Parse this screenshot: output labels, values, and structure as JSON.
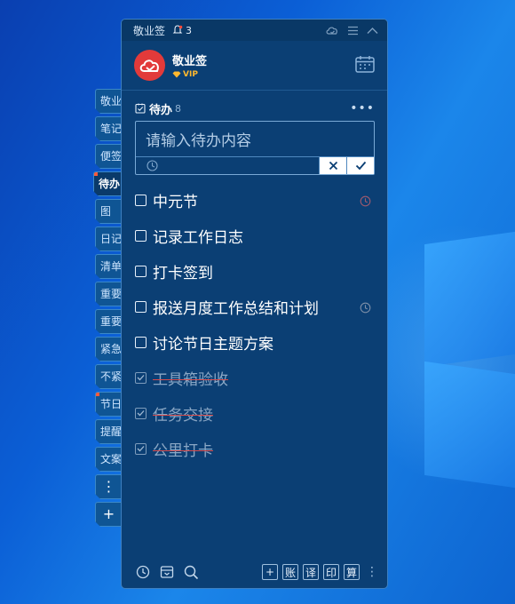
{
  "titlebar": {
    "app_name": "敬业签",
    "notification_count": "3"
  },
  "profile": {
    "name": "敬业签",
    "badge": "VIP"
  },
  "side_tabs": [
    {
      "label": "敬业"
    },
    {
      "label": "笔记"
    },
    {
      "label": "便签"
    },
    {
      "label": "待办",
      "active": true
    },
    {
      "label": "图"
    },
    {
      "label": "日记"
    },
    {
      "label": "清单"
    },
    {
      "label": "重要"
    },
    {
      "label": "重要"
    },
    {
      "label": "紧急"
    },
    {
      "label": "不紧"
    },
    {
      "label": "节日"
    },
    {
      "label": "提醒"
    },
    {
      "label": "文案"
    }
  ],
  "section": {
    "label": "待办",
    "count": "8"
  },
  "input": {
    "placeholder": "请输入待办内容"
  },
  "todos": [
    {
      "text": "中元节",
      "done": false,
      "alarm": true
    },
    {
      "text": "记录工作日志",
      "done": false,
      "alarm": false
    },
    {
      "text": "打卡签到",
      "done": false,
      "alarm": false
    },
    {
      "text": "报送月度工作总结和计划",
      "done": false,
      "alarm": true
    },
    {
      "text": "讨论节日主题方案",
      "done": false,
      "alarm": false
    },
    {
      "text": "工具箱验收",
      "done": true,
      "alarm": false
    },
    {
      "text": "任务交接",
      "done": true,
      "alarm": false
    },
    {
      "text": "公里打卡",
      "done": true,
      "alarm": false
    }
  ],
  "footer_tools": [
    {
      "label": "+"
    },
    {
      "label": "账"
    },
    {
      "label": "译"
    },
    {
      "label": "印"
    },
    {
      "label": "算"
    }
  ],
  "colors": {
    "panel_bg": "#0b3f74",
    "accent_red": "#e23a3a",
    "vip_gold": "#ffb92e"
  }
}
